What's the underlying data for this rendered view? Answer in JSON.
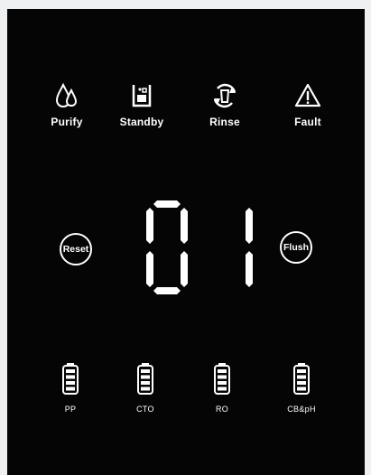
{
  "status_icons": [
    {
      "label": "Purify",
      "icon": "water-drop-icon"
    },
    {
      "label": "Standby",
      "icon": "cup-icon"
    },
    {
      "label": "Rinse",
      "icon": "rinse-cycle-icon"
    },
    {
      "label": "Fault",
      "icon": "warning-triangle-icon"
    }
  ],
  "buttons": {
    "reset": "Reset",
    "flush": "Flush"
  },
  "display": {
    "value": "01"
  },
  "filters": [
    {
      "label": "PP",
      "level_bars": 4
    },
    {
      "label": "CTO",
      "level_bars": 4
    },
    {
      "label": "RO",
      "level_bars": 4
    },
    {
      "label": "CB&pH",
      "level_bars": 4
    }
  ],
  "colors": {
    "panel": "#050505",
    "foreground": "#ffffff",
    "page": "#eef0f2"
  }
}
